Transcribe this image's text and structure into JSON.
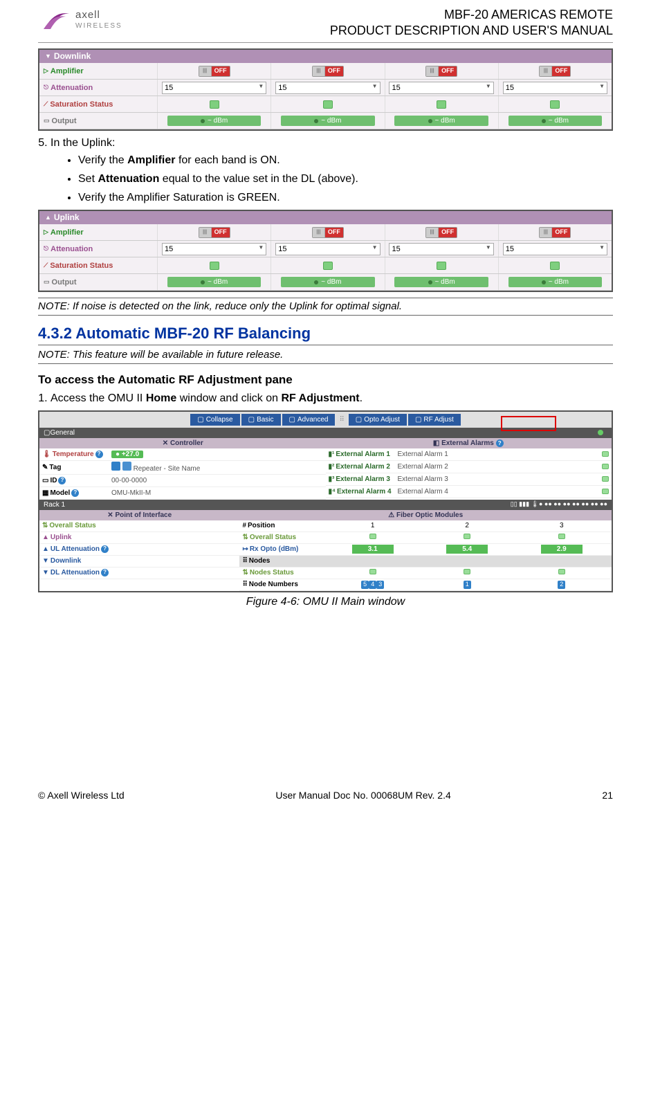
{
  "header": {
    "logo_name": "axell",
    "logo_sub": "WIRELESS",
    "title1": "MBF-20 AMERICAS REMOTE",
    "title2": "PRODUCT DESCRIPTION AND USER'S MANUAL"
  },
  "downlink": {
    "title": "Downlink",
    "rows": {
      "amplifier": "Amplifier",
      "attenuation": "Attenuation",
      "saturation": "Saturation Status",
      "output": "Output"
    },
    "off": "OFF",
    "attn": "15",
    "dbm": "~ dBm"
  },
  "step5": {
    "num": "5.",
    "lead": "In the Uplink:",
    "b1a": "Verify the ",
    "b1b": "Amplifier",
    "b1c": " for each band is ON.",
    "b2a": "Set ",
    "b2b": "Attenuation",
    "b2c": " equal to the value set in the DL (above).",
    "b3": "Verify the Amplifier Saturation is GREEN."
  },
  "uplink": {
    "title": "Uplink",
    "rows": {
      "amplifier": "Amplifier",
      "attenuation": "Attenuation",
      "saturation": "Saturation Status",
      "output": "Output"
    },
    "off": "OFF",
    "attn": "15",
    "dbm": "~ dBm"
  },
  "note1": "NOTE: If noise is detected on the link, reduce only the Uplink for optimal signal.",
  "h2": "4.3.2   Automatic MBF-20 RF Balancing",
  "note2": "NOTE: This feature will be available in future release.",
  "h3": "To access the Automatic RF Adjustment pane",
  "step1": {
    "num": "1.",
    "a": "Access the OMU II ",
    "b": "Home",
    "c": " window and click on ",
    "d": "RF Adjustment",
    "e": "."
  },
  "fig3": {
    "toolbar": {
      "collapse": "Collapse",
      "basic": "Basic",
      "advanced": "Advanced",
      "opto": "Opto Adjust",
      "rf": "RF Adjust"
    },
    "general": "General",
    "controller": "Controller",
    "ext_alarms": "External Alarms",
    "temp": "Temperature",
    "temp_val": "+27.0",
    "tag": "Tag",
    "tag_val": "Repeater - Site Name",
    "id": "ID",
    "id_val": "00-00-0000",
    "model": "Model",
    "model_val": "OMU-MkII-M",
    "ea1": "External Alarm 1",
    "ea1v": "External Alarm 1",
    "ea2": "External Alarm 2",
    "ea2v": "External Alarm 2",
    "ea3": "External Alarm 3",
    "ea3v": "External Alarm 3",
    "ea4": "External Alarm 4",
    "ea4v": "External Alarm 4",
    "rack": "Rack 1",
    "poi": "Point of Interface",
    "fom": "Fiber Optic Modules",
    "overall": "Overall Status",
    "uplink": "Uplink",
    "ulatt": "UL Attenuation",
    "downlink": "Downlink",
    "dlatt": "DL Attenuation",
    "position": "Position",
    "p1": "1",
    "p2": "2",
    "p3": "3",
    "rxopto": "Rx Opto (dBm)",
    "rx1": "3.1",
    "rx2": "5.4",
    "rx3": "2.9",
    "nodes": "Nodes",
    "nstatus": "Nodes Status",
    "nnum": "Node Numbers",
    "nn1a": "5",
    "nn1b": "4",
    "nn1c": "3",
    "nn2": "1",
    "nn3": "2"
  },
  "figcap": "Figure 4-6: OMU II Main window",
  "footer": {
    "left": "© Axell Wireless Ltd",
    "mid": "User Manual Doc No. 00068UM Rev. 2.4",
    "right": "21"
  }
}
